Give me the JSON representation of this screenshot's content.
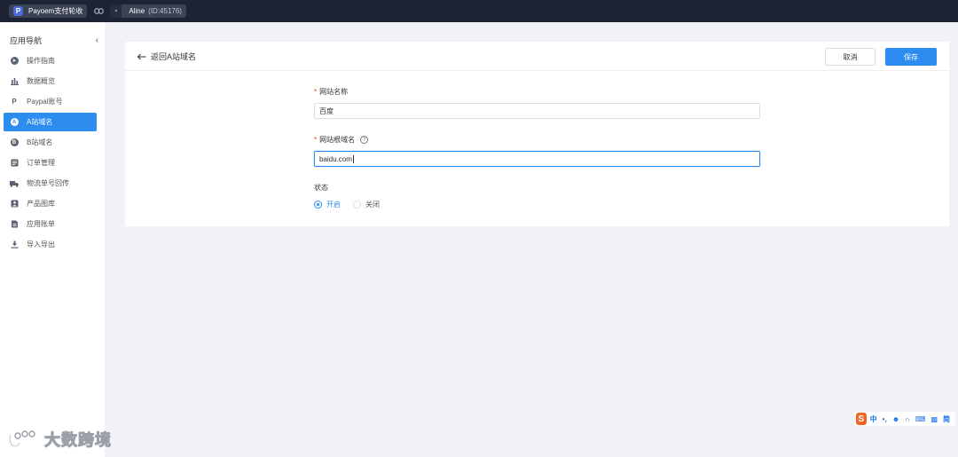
{
  "topbar": {
    "app_badge": "P",
    "app_name": "Payoem支付轮收",
    "user_name": "Aline",
    "user_id": "(ID:45176)"
  },
  "sidebar": {
    "title": "应用导航",
    "collapse_icon": "‹",
    "items": [
      {
        "label": "操作指南",
        "icon": "compass-icon"
      },
      {
        "label": "数据概览",
        "icon": "bar-chart-icon"
      },
      {
        "label": "Paypal账号",
        "icon": "paypal-icon"
      },
      {
        "label": "A站域名",
        "icon": "letter-a-icon"
      },
      {
        "label": "B站域名",
        "icon": "letter-b-icon"
      },
      {
        "label": "订单管理",
        "icon": "order-list-icon"
      },
      {
        "label": "物流单号回传",
        "icon": "truck-icon"
      },
      {
        "label": "产品图库",
        "icon": "image-library-icon"
      },
      {
        "label": "应用账单",
        "icon": "bill-icon"
      },
      {
        "label": "导入导出",
        "icon": "download-icon"
      }
    ],
    "active_index": 3
  },
  "page": {
    "back_label": "返回A站域名",
    "cancel_label": "取消",
    "save_label": "保存"
  },
  "form": {
    "site_name_label": "网站名称",
    "site_name_value": "百度",
    "root_domain_label": "网站根域名",
    "root_domain_value": "baidu.com",
    "status_label": "状态",
    "status_on": "开启",
    "status_off": "关闭",
    "status_selected": "开启"
  },
  "ime": {
    "logo": "S",
    "mode": "中",
    "punct": "•,",
    "simp": "简"
  },
  "watermark": {
    "text": "大数跨境"
  },
  "colors": {
    "accent": "#2d8cf0",
    "topbar": "#1c2333",
    "background": "#f0f2f5",
    "required": "#ed4014"
  }
}
